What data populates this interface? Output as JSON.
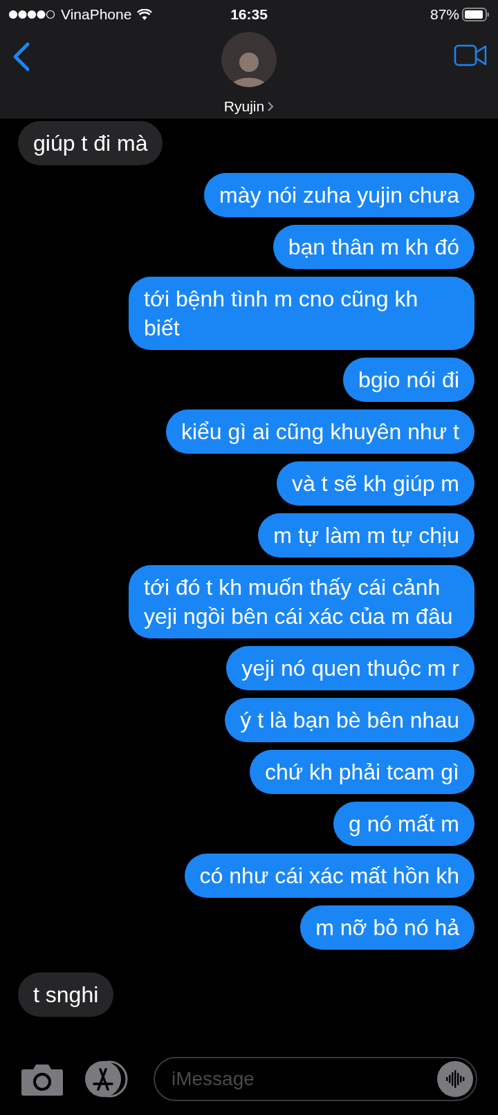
{
  "status_bar": {
    "carrier": "VinaPhone",
    "time": "16:35",
    "battery": "87%"
  },
  "header": {
    "contact": "Ryujin"
  },
  "messages": [
    {
      "kind": "received",
      "text": "giúp t đi mà"
    },
    {
      "kind": "sent",
      "text": "mày nói zuha yujin chưa"
    },
    {
      "kind": "sent",
      "text": "bạn thân m kh đó"
    },
    {
      "kind": "sent",
      "text": "tới bệnh tình m cno cũng kh biết"
    },
    {
      "kind": "sent",
      "text": "bgio nói đi"
    },
    {
      "kind": "sent",
      "text": "kiểu gì ai cũng khuyên như t"
    },
    {
      "kind": "sent",
      "text": "và t sẽ kh giúp m"
    },
    {
      "kind": "sent",
      "text": "m tự làm m tự chịu"
    },
    {
      "kind": "sent",
      "text": "tới đó t kh muốn thấy cái cảnh yeji ngồi bên cái xác của m đâu"
    },
    {
      "kind": "sent",
      "text": "yeji nó quen thuộc m r"
    },
    {
      "kind": "sent",
      "text": "ý t là bạn bè bên nhau"
    },
    {
      "kind": "sent",
      "text": "chứ kh phải tcam gì"
    },
    {
      "kind": "sent",
      "text": "g nó mất m"
    },
    {
      "kind": "sent",
      "text": "có như cái xác mất hồn kh"
    },
    {
      "kind": "sent",
      "text": "m nỡ bỏ nó hả"
    },
    {
      "kind": "received",
      "text": "t snghi"
    }
  ],
  "composer": {
    "placeholder": "iMessage"
  }
}
